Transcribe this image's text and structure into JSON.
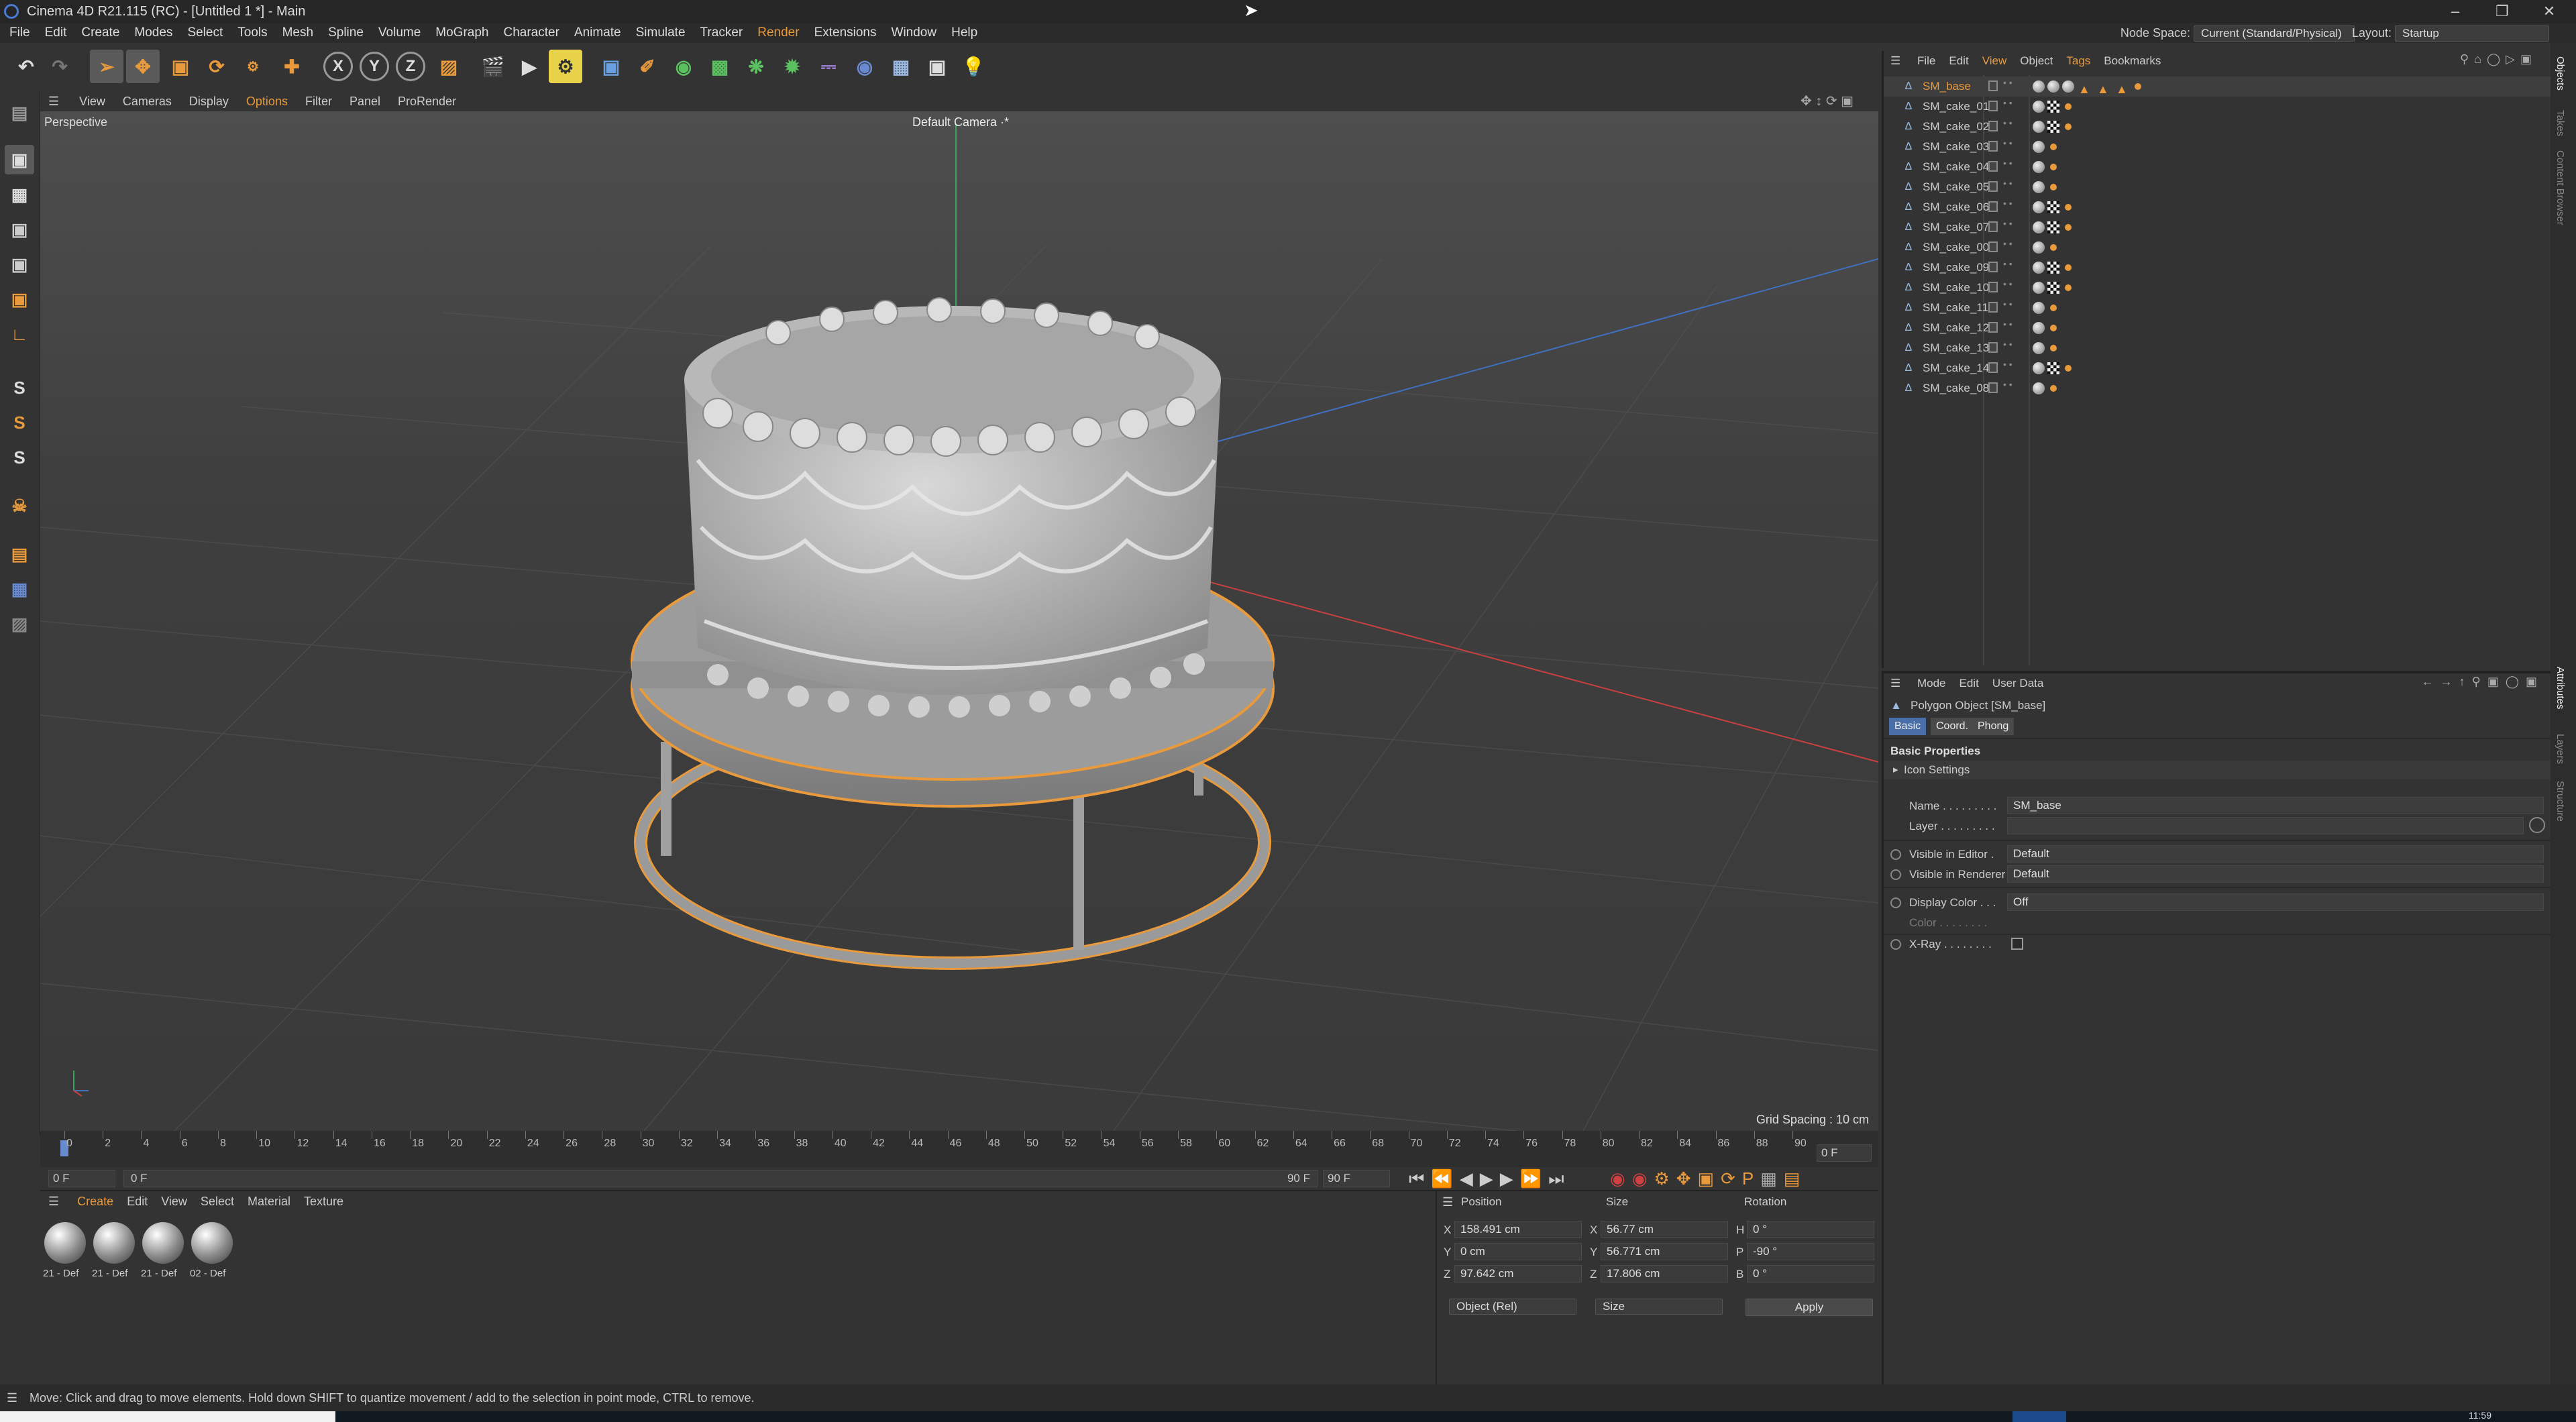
{
  "window": {
    "title": "Cinema 4D R21.115 (RC) - [Untitled 1 *] - Main"
  },
  "menu": [
    "File",
    "Edit",
    "Create",
    "Modes",
    "Select",
    "Tools",
    "Mesh",
    "Spline",
    "Volume",
    "MoGraph",
    "Character",
    "Animate",
    "Simulate",
    "Tracker",
    "Render",
    "Extensions",
    "Window",
    "Help"
  ],
  "header": {
    "node_space_label": "Node Space:",
    "node_space_value": "Current (Standard/Physical)",
    "layout_label": "Layout:",
    "layout_value": "Startup"
  },
  "toolbar": {
    "axis_x": "X",
    "axis_y": "Y",
    "axis_z": "Z"
  },
  "viewport": {
    "menu": [
      "View",
      "Cameras",
      "Display",
      "Options",
      "Filter",
      "Panel",
      "ProRender"
    ],
    "label": "Perspective",
    "camera": "Default Camera ·*",
    "grid_spacing": "Grid Spacing : 10 cm"
  },
  "timeline": {
    "ticks": [
      "0",
      "2",
      "4",
      "6",
      "8",
      "10",
      "12",
      "14",
      "16",
      "18",
      "20",
      "22",
      "24",
      "26",
      "28",
      "30",
      "32",
      "34",
      "36",
      "38",
      "40",
      "42",
      "44",
      "46",
      "48",
      "50",
      "52",
      "54",
      "56",
      "58",
      "60",
      "62",
      "64",
      "66",
      "68",
      "70",
      "72",
      "74",
      "76",
      "78",
      "80",
      "82",
      "84",
      "86",
      "88",
      "90"
    ],
    "current_frame": "0 F",
    "start_field": "0 F",
    "start_field2": "0 F",
    "end_field": "90 F",
    "end_field2": "90 F",
    "right_frame": "0 F"
  },
  "materials": {
    "menu": [
      "Create",
      "Edit",
      "View",
      "Select",
      "Material",
      "Texture"
    ],
    "items": [
      "21 - Def",
      "21 - Def",
      "21 - Def",
      "02 - Def"
    ]
  },
  "coords": {
    "headers": {
      "position": "Position",
      "size": "Size",
      "rotation": "Rotation"
    },
    "rows": [
      {
        "axis": "X",
        "pos": "158.491 cm",
        "saxis": "X",
        "size": "56.77 cm",
        "raxis": "H",
        "rot": "0 °"
      },
      {
        "axis": "Y",
        "pos": "0 cm",
        "saxis": "Y",
        "size": "56.771 cm",
        "raxis": "P",
        "rot": "-90 °"
      },
      {
        "axis": "Z",
        "pos": "97.642 cm",
        "saxis": "Z",
        "size": "17.806 cm",
        "raxis": "B",
        "rot": "0 °"
      }
    ],
    "mode": "Object (Rel)",
    "size_mode": "Size",
    "apply": "Apply"
  },
  "object_manager": {
    "menu": [
      "File",
      "Edit",
      "View",
      "Object",
      "Tags",
      "Bookmarks"
    ],
    "objects": [
      {
        "name": "SM_base",
        "selected": true
      },
      {
        "name": "SM_cake_01"
      },
      {
        "name": "SM_cake_02"
      },
      {
        "name": "SM_cake_03"
      },
      {
        "name": "SM_cake_04"
      },
      {
        "name": "SM_cake_05"
      },
      {
        "name": "SM_cake_06"
      },
      {
        "name": "SM_cake_07"
      },
      {
        "name": "SM_cake_00"
      },
      {
        "name": "SM_cake_09"
      },
      {
        "name": "SM_cake_10"
      },
      {
        "name": "SM_cake_11"
      },
      {
        "name": "SM_cake_12"
      },
      {
        "name": "SM_cake_13"
      },
      {
        "name": "SM_cake_14"
      },
      {
        "name": "SM_cake_08"
      }
    ]
  },
  "attributes": {
    "menu": [
      "Mode",
      "Edit",
      "User Data"
    ],
    "object_title": "Polygon Object [SM_base]",
    "tabs": [
      "Basic",
      "Coord.",
      "Phong"
    ],
    "section": "Basic Properties",
    "icon_settings": "Icon Settings",
    "name_label": "Name . . . . . . . . .",
    "name_value": "SM_base",
    "layer_label": "Layer . . . . . . . . .",
    "vis_editor_label": "Visible in Editor .",
    "vis_editor_value": "Default",
    "vis_render_label": "Visible in Renderer",
    "vis_render_value": "Default",
    "display_color_label": "Display Color . . .",
    "display_color_value": "Off",
    "color_label": "Color . . . . . . . .",
    "xray_label": "X-Ray . . . . . . . ."
  },
  "right_tabs": [
    "Objects",
    "Takes",
    "Content Browser",
    "Attributes",
    "Layers",
    "Structure"
  ],
  "status": {
    "text": "Move: Click and drag to move elements. Hold down SHIFT to quantize movement / add to the selection in point mode, CTRL to remove.",
    "clock": "11:59"
  },
  "colors": {
    "accent": "#e89a3c",
    "selection_blue": "#4a7bd0",
    "axis_x": "#c84040",
    "axis_y": "#40a060",
    "axis_z": "#4070c0"
  }
}
